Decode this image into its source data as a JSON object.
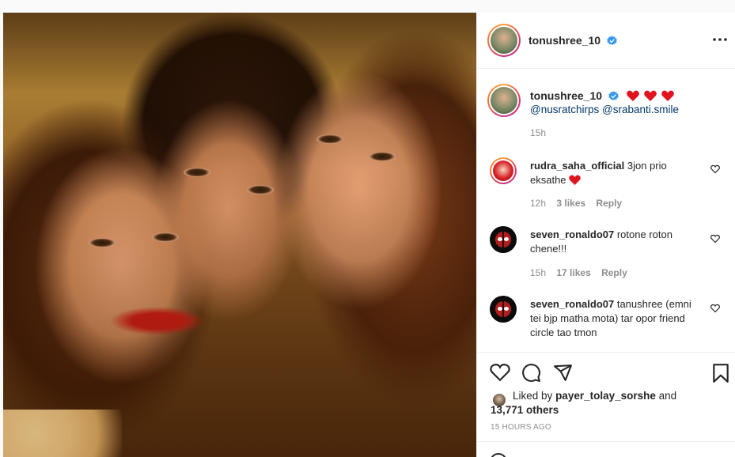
{
  "post": {
    "author": "tonushree_10",
    "verified": true
  },
  "caption": {
    "username": "tonushree_10",
    "mentions": [
      "@nusratchirps",
      "@srabanti.smile"
    ],
    "time": "15h"
  },
  "comments": [
    {
      "username": "rudra_saha_official",
      "text": "3jon prio eksathe",
      "time": "12h",
      "likes": "3 likes",
      "reply": "Reply"
    },
    {
      "username": "seven_ronaldo07",
      "text": "rotone roton chene!!!",
      "time": "15h",
      "likes": "17 likes",
      "reply": "Reply"
    },
    {
      "username": "seven_ronaldo07",
      "text": "tanushree (emni tei bjp matha mota) tar opor friend circle tao tmon"
    }
  ],
  "likes": {
    "prefix": "Liked by",
    "user": "payer_tolay_sorshe",
    "and": "and",
    "others": "13,771 others"
  },
  "timestamp": "15 HOURS AGO",
  "colors": {
    "verified": "#3897f0",
    "heart": "#ed4956",
    "link": "#00376b",
    "muted": "#8e8e8e"
  },
  "icons": [
    "more-options-icon",
    "verified-badge-icon",
    "heart-icon",
    "comment-icon",
    "share-icon",
    "save-icon",
    "red-heart-emoji"
  ]
}
